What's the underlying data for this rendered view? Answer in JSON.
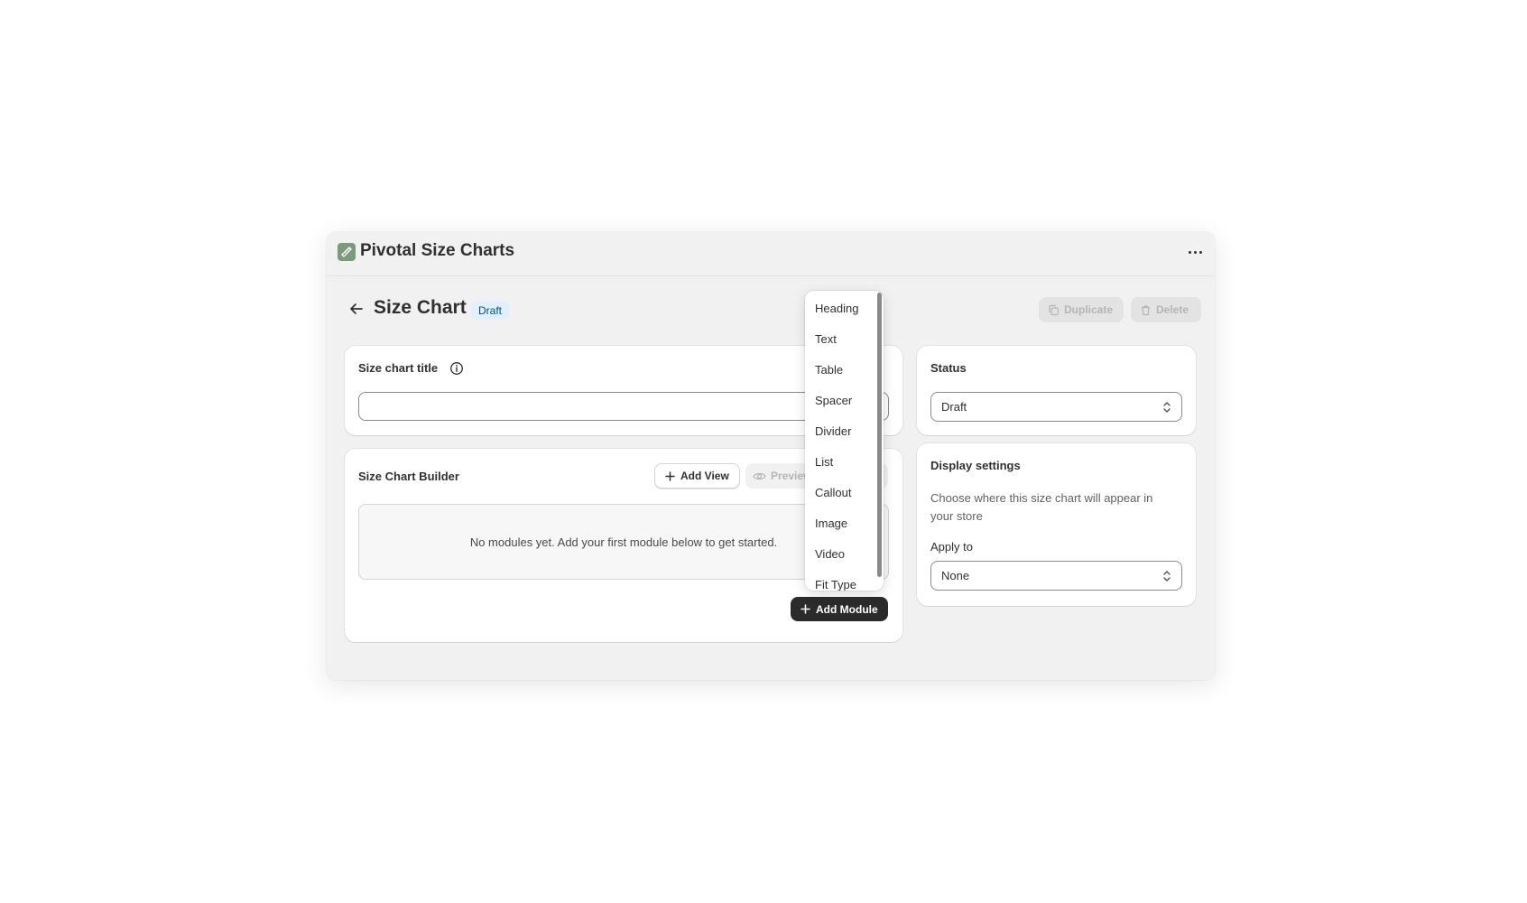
{
  "app": {
    "title": "Pivotal Size Charts"
  },
  "page": {
    "title": "Size Chart",
    "status_badge": "Draft",
    "duplicate_label": "Duplicate",
    "delete_label": "Delete"
  },
  "title_card": {
    "label": "Size chart title",
    "input_value": ""
  },
  "builder": {
    "title": "Size Chart Builder",
    "add_view_label": "Add View",
    "preview_label": "Preview",
    "empty_message": "No modules yet. Add your first module below to get started.",
    "add_module_label": "Add Module"
  },
  "status_card": {
    "title": "Status",
    "selected": "Draft"
  },
  "display_card": {
    "title": "Display settings",
    "description": "Choose where this size chart will appear in your store",
    "apply_label": "Apply to",
    "selected": "None"
  },
  "module_menu": {
    "items": [
      "Heading",
      "Text",
      "Table",
      "Spacer",
      "Divider",
      "List",
      "Callout",
      "Image",
      "Video",
      "Fit Type"
    ]
  },
  "icons": {
    "logo": "ruler-icon",
    "more": "more-horizontal-icon",
    "back": "arrow-left-icon",
    "info": "info-icon",
    "duplicate": "copy-icon",
    "delete": "trash-icon",
    "add": "plus-icon",
    "preview": "eye-icon",
    "select": "chevron-up-down-icon"
  }
}
